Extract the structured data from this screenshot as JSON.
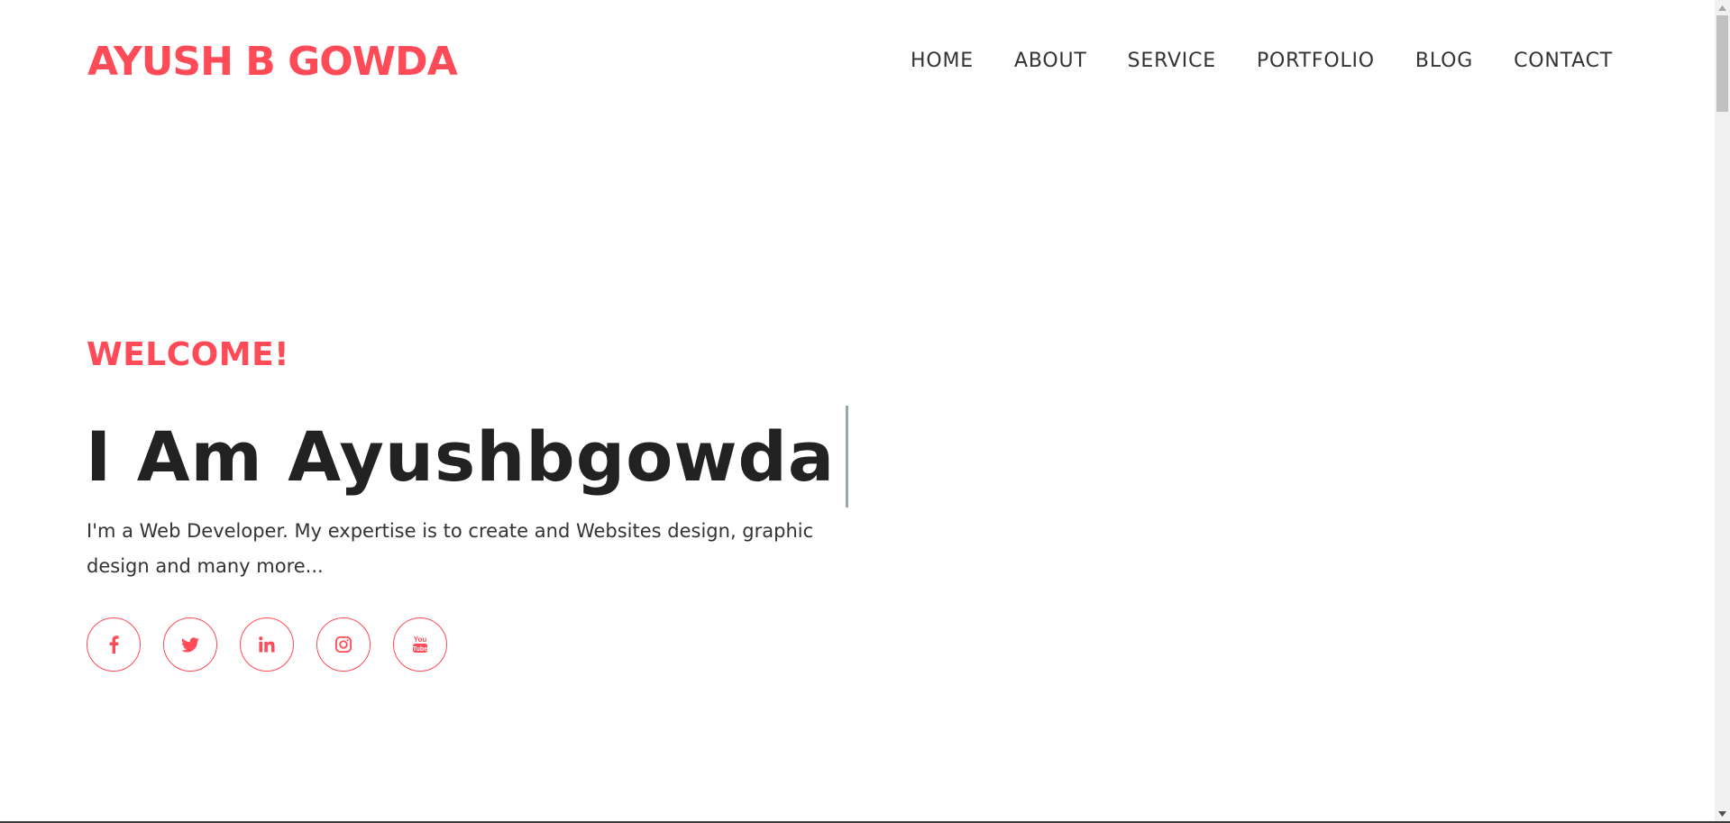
{
  "header": {
    "logo": "AYUSH B GOWDA",
    "nav": [
      {
        "label": "HOME"
      },
      {
        "label": "ABOUT"
      },
      {
        "label": "SERVICE"
      },
      {
        "label": "PORTFOLIO"
      },
      {
        "label": "BLOG"
      },
      {
        "label": "CONTACT"
      }
    ]
  },
  "hero": {
    "welcome": "WELCOME!",
    "headline": "I Am Ayushbgowda",
    "description": "I'm a Web Developer. My expertise is to create and Websites design, graphic design and many more...",
    "socials": [
      {
        "icon": "facebook-icon"
      },
      {
        "icon": "twitter-icon"
      },
      {
        "icon": "linkedin-icon"
      },
      {
        "icon": "instagram-icon"
      },
      {
        "icon": "youtube-icon"
      }
    ]
  },
  "colors": {
    "accent": "#ff4a57",
    "text": "#222222",
    "nav_text": "#333333",
    "caret": "#9aa8ad"
  }
}
